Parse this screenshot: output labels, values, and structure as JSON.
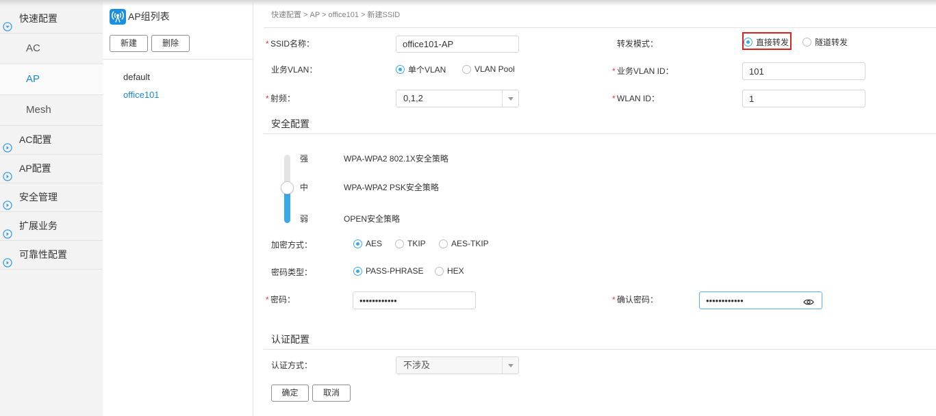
{
  "theme": {
    "accent": "#3aa9ea",
    "selected_text": "#1b86d4",
    "required_mark": "#e53935",
    "highlight_box": "#e0201f"
  },
  "sidebar": {
    "quick_config": {
      "label": "快速配置",
      "icon": "chevron-down-circle-icon",
      "expanded": true
    },
    "sub_items": [
      {
        "label": "AC",
        "selected": false
      },
      {
        "label": "AP",
        "selected": true
      },
      {
        "label": "Mesh",
        "selected": false
      }
    ],
    "groups": [
      {
        "label": "AC配置",
        "icon": "chevron-right-circle-icon"
      },
      {
        "label": "AP配置",
        "icon": "chevron-right-circle-icon"
      },
      {
        "label": "安全管理",
        "icon": "chevron-right-circle-icon"
      },
      {
        "label": "扩展业务",
        "icon": "chevron-right-circle-icon"
      },
      {
        "label": "可靠性配置",
        "icon": "chevron-right-circle-icon"
      }
    ]
  },
  "ap_group_panel": {
    "title": "AP组列表",
    "icon": "ap-wireless-icon",
    "new_button": "新建",
    "delete_button": "删除",
    "groups": [
      {
        "name": "default",
        "selected": false
      },
      {
        "name": "office101",
        "selected": true
      }
    ]
  },
  "breadcrumb": "快速配置 > AP > office101 > 新建SSID",
  "form": {
    "required_mark": "*",
    "ssid_name": {
      "label": "SSID名称：",
      "value": "office101-AP"
    },
    "forward_mode": {
      "label": "转发模式：",
      "options": [
        "直接转发",
        "隧道转发"
      ],
      "selected": "直接转发"
    },
    "service_vlan": {
      "label": "业务VLAN：",
      "options": [
        "单个VLAN",
        "VLAN Pool"
      ],
      "selected": "单个VLAN"
    },
    "service_vlan_id": {
      "label": "业务VLAN ID：",
      "value": "101"
    },
    "radio_band": {
      "label": "射频：",
      "value": "0,1,2"
    },
    "wlan_id": {
      "label": "WLAN ID：",
      "value": "1"
    },
    "security": {
      "section_title": "安全配置",
      "levels": [
        {
          "level": "强",
          "policy": "WPA-WPA2 802.1X安全策略"
        },
        {
          "level": "中",
          "policy": "WPA-WPA2 PSK安全策略"
        },
        {
          "level": "弱",
          "policy": "OPEN安全策略"
        }
      ],
      "selected_level": "中",
      "encryption": {
        "label": "加密方式：",
        "options": [
          "AES",
          "TKIP",
          "AES-TKIP"
        ],
        "selected": "AES"
      },
      "password_type": {
        "label": "密码类型：",
        "options": [
          "PASS-PHRASE",
          "HEX"
        ],
        "selected": "PASS-PHRASE"
      },
      "password": {
        "label": "密码：",
        "value": "••••••••••••"
      },
      "confirm_password": {
        "label": "确认密码：",
        "value": "••••••••••••",
        "icon": "eye-icon"
      }
    },
    "auth": {
      "section_title": "认证配置",
      "method": {
        "label": "认证方式：",
        "value": "不涉及"
      }
    },
    "ok_button": "确定",
    "cancel_button": "取消"
  }
}
